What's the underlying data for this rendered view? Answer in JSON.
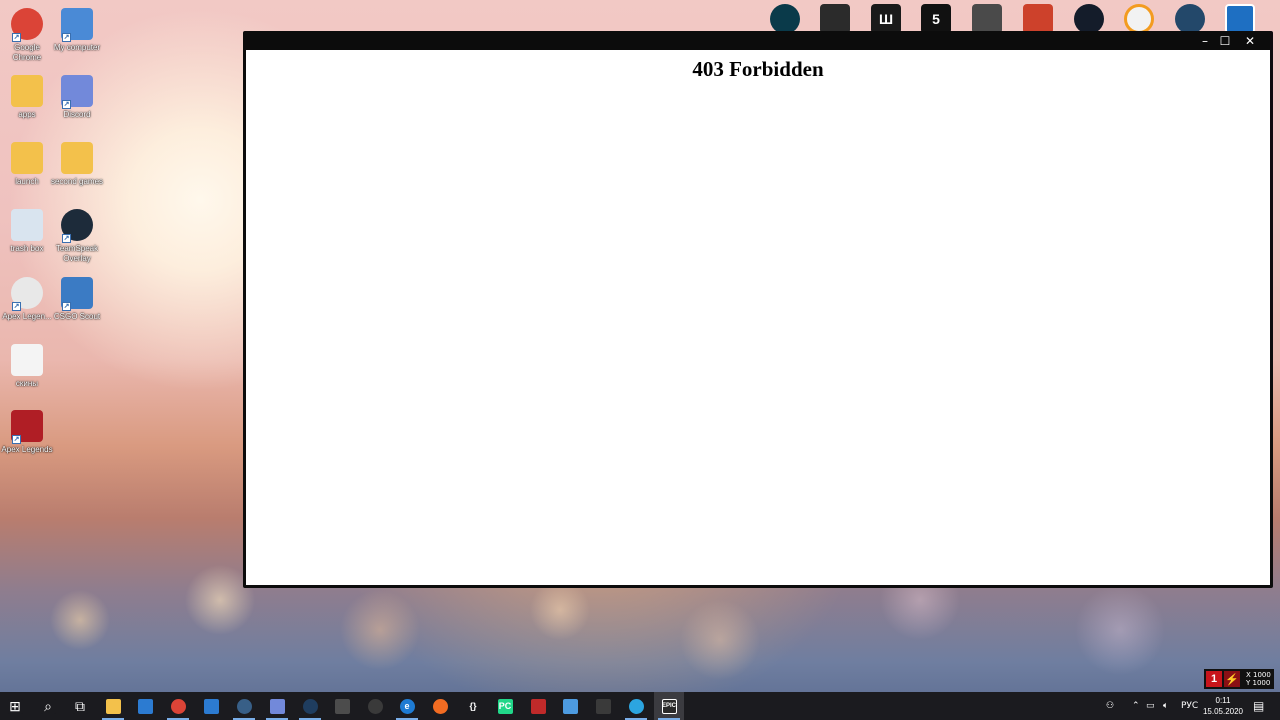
{
  "desktop": {
    "icons": [
      {
        "label": "Google Chrome",
        "icon": "chrome-icon",
        "color": "#db4437"
      },
      {
        "label": "My computer",
        "icon": "computer-icon",
        "color": "#4a8ad6"
      },
      {
        "label": "apps",
        "icon": "folder-icon",
        "color": "#f3c14b"
      },
      {
        "label": "Discord",
        "icon": "discord-icon",
        "color": "#7289da"
      },
      {
        "label": "launch",
        "icon": "folder-icon",
        "color": "#f3c14b"
      },
      {
        "label": "second games",
        "icon": "folder-icon",
        "color": "#f3c14b"
      },
      {
        "label": "trash box",
        "icon": "recycle-bin-icon",
        "color": "#d9e4ef"
      },
      {
        "label": "TeamSpeak Overlay",
        "icon": "teamspeak-icon",
        "color": "#1d2b3a"
      },
      {
        "label": "Apex Legen...",
        "icon": "apex-icon",
        "color": "#e8e8e8"
      },
      {
        "label": "CSGO Scout",
        "icon": "csgo-scout-icon",
        "color": "#3b7bc4"
      },
      {
        "label": "скины",
        "icon": "text-file-icon",
        "color": "#f4f4f4"
      },
      {
        "label": "Apex Legends",
        "icon": "apex-icon",
        "color": "#b01e25"
      }
    ],
    "top_icons": [
      {
        "icon": "league-of-legends-icon",
        "color": "#0a3a4a",
        "glyph": ""
      },
      {
        "icon": "rubiks-cube-icon",
        "color": "#2b2b2b",
        "glyph": ""
      },
      {
        "icon": "faceit-icon",
        "color": "#1a1a1a",
        "glyph": "Ш"
      },
      {
        "icon": "gta5-icon",
        "color": "#111111",
        "glyph": "5"
      },
      {
        "icon": "game-character-icon",
        "color": "#4a4a4a",
        "glyph": ""
      },
      {
        "icon": "rust-icon",
        "color": "#cd412b",
        "glyph": ""
      },
      {
        "icon": "wolf-game-icon",
        "color": "#141c2a",
        "glyph": ""
      },
      {
        "icon": "overwatch-icon",
        "color": "#f2f2f2",
        "glyph": ""
      },
      {
        "icon": "headset-app-icon",
        "color": "#23486a",
        "glyph": ""
      },
      {
        "icon": "settings-app-icon",
        "color": "#1e6fc2",
        "glyph": ""
      }
    ]
  },
  "window": {
    "heading": "403 Forbidden",
    "controls": {
      "minimize": "–",
      "maximize": "☐",
      "close": "✕"
    }
  },
  "tray_widget": {
    "digit": "1",
    "x_text": "X 1000",
    "y_text": "Y 1000"
  },
  "taskbar": {
    "apps": [
      {
        "icon": "start-icon",
        "glyph": "⊞",
        "color": "#1b1b1f"
      },
      {
        "icon": "search-icon",
        "glyph": "⌕",
        "color": "#1b1b1f"
      },
      {
        "icon": "task-view-icon",
        "glyph": "⧉",
        "color": "#1b1b1f"
      },
      {
        "icon": "file-explorer-icon",
        "glyph": "",
        "color": "#f3c14b"
      },
      {
        "icon": "microsoft-store-icon",
        "glyph": "",
        "color": "#2c7bd1"
      },
      {
        "icon": "chrome-icon",
        "glyph": "",
        "color": "#db4437"
      },
      {
        "icon": "mail-icon",
        "glyph": "",
        "color": "#2c7bd1"
      },
      {
        "icon": "teamspeak-icon",
        "glyph": "",
        "color": "#385f87"
      },
      {
        "icon": "discord-icon",
        "glyph": "",
        "color": "#7289da"
      },
      {
        "icon": "steam-icon",
        "glyph": "",
        "color": "#1f3d5f"
      },
      {
        "icon": "calculator-icon",
        "glyph": "",
        "color": "#4c4c4c"
      },
      {
        "icon": "obs-icon",
        "glyph": "",
        "color": "#3a3a3a"
      },
      {
        "icon": "edge-icon",
        "glyph": "e",
        "color": "#1e7bd3"
      },
      {
        "icon": "origin-icon",
        "glyph": "",
        "color": "#f26c22"
      },
      {
        "icon": "code-editor-icon",
        "glyph": "{}",
        "color": "#1b1b1f"
      },
      {
        "icon": "pycharm-icon",
        "glyph": "PC",
        "color": "#21d789"
      },
      {
        "icon": "game-red-icon",
        "glyph": "",
        "color": "#c02a2a"
      },
      {
        "icon": "window-app-icon",
        "glyph": "",
        "color": "#4d9be0"
      },
      {
        "icon": "rubiks-cube-icon",
        "glyph": "",
        "color": "#3a3a3a"
      },
      {
        "icon": "telegram-icon",
        "glyph": "",
        "color": "#2ca5e0"
      },
      {
        "icon": "epic-games-icon",
        "glyph": "EPIC",
        "color": "#2a2a2a"
      }
    ],
    "tray": {
      "language": "РУС",
      "time": "0:11",
      "date": "15.05.2020"
    }
  }
}
